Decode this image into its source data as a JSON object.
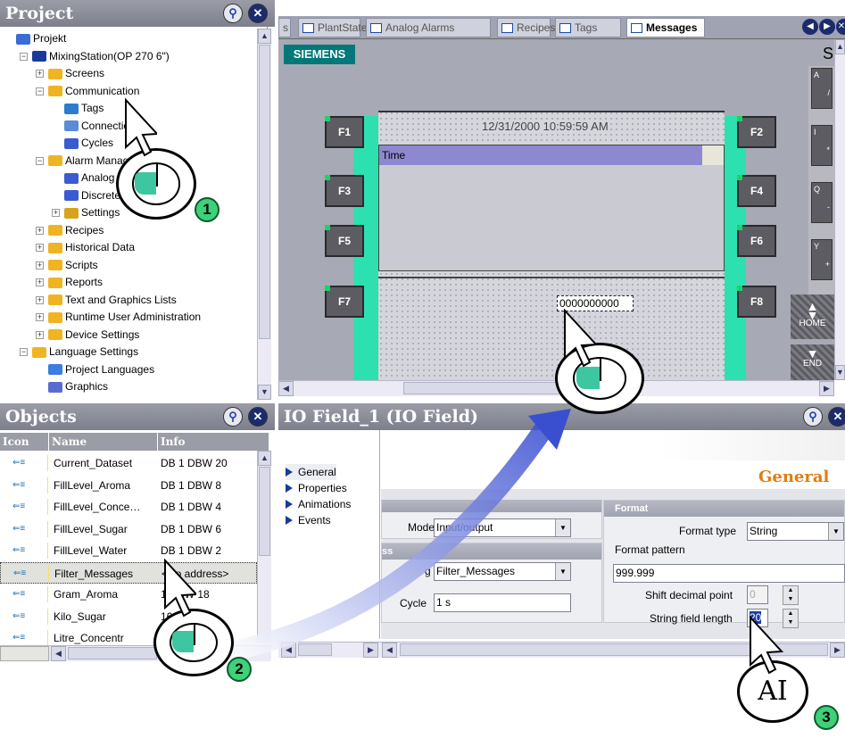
{
  "project_panel": {
    "title": "Project",
    "tree": [
      {
        "label": "Projekt",
        "level": 0,
        "icon": "project-icon",
        "expander": ""
      },
      {
        "label": "MixingStation(OP 270 6\")",
        "level": 1,
        "icon": "device-icon",
        "expander": "−"
      },
      {
        "label": "Screens",
        "level": 2,
        "icon": "folder-icon",
        "expander": "+"
      },
      {
        "label": "Communication",
        "level": 2,
        "icon": "folder-open-icon",
        "expander": "−"
      },
      {
        "label": "Tags",
        "level": 3,
        "icon": "tags-icon",
        "expander": ""
      },
      {
        "label": "Connections",
        "level": 3,
        "icon": "connections-icon",
        "expander": ""
      },
      {
        "label": "Cycles",
        "level": 3,
        "icon": "cycles-icon",
        "expander": ""
      },
      {
        "label": "Alarm Management",
        "level": 2,
        "icon": "folder-open-icon",
        "expander": "−"
      },
      {
        "label": "Analog Alarms",
        "level": 3,
        "icon": "analog-alarm-icon",
        "expander": ""
      },
      {
        "label": "Discrete Alarms",
        "level": 3,
        "icon": "discrete-alarm-icon",
        "expander": ""
      },
      {
        "label": "Settings",
        "level": 3,
        "icon": "settings-icon",
        "expander": "+"
      },
      {
        "label": "Recipes",
        "level": 2,
        "icon": "folder-icon",
        "expander": "+"
      },
      {
        "label": "Historical Data",
        "level": 2,
        "icon": "folder-icon",
        "expander": "+"
      },
      {
        "label": "Scripts",
        "level": 2,
        "icon": "folder-icon",
        "expander": "+"
      },
      {
        "label": "Reports",
        "level": 2,
        "icon": "folder-icon",
        "expander": "+"
      },
      {
        "label": "Text and Graphics Lists",
        "level": 2,
        "icon": "folder-icon",
        "expander": "+"
      },
      {
        "label": "Runtime User Administration",
        "level": 2,
        "icon": "folder-icon",
        "expander": "+"
      },
      {
        "label": "Device Settings",
        "level": 2,
        "icon": "folder-icon",
        "expander": "+"
      },
      {
        "label": "Language Settings",
        "level": 1,
        "icon": "folder-open-icon",
        "expander": "−"
      },
      {
        "label": "Project Languages",
        "level": 2,
        "icon": "globe-icon",
        "expander": ""
      },
      {
        "label": "Graphics",
        "level": 2,
        "icon": "graphics-icon",
        "expander": ""
      }
    ]
  },
  "tabs": [
    {
      "label": "s",
      "icon": ""
    },
    {
      "label": "PlantState",
      "icon": "screen-icon"
    },
    {
      "label": "Analog Alarms",
      "icon": "analog-alarm-icon"
    },
    {
      "label": "Recipes",
      "icon": "screen-icon"
    },
    {
      "label": "Tags",
      "icon": "tags-icon"
    },
    {
      "label": "Messages",
      "icon": "screen-icon",
      "active": true
    }
  ],
  "screen": {
    "brand": "SIEMENS",
    "corner_letter": "S",
    "datetime": "12/31/2000 10:59:59 AM",
    "column_time": "Time",
    "io_field_value": "0000000000",
    "fkeys_left": [
      "F1",
      "F3",
      "F5",
      "F7"
    ],
    "fkeys_right": [
      "F2",
      "F4",
      "F6",
      "F8"
    ],
    "side_keys": [
      {
        "top": "A",
        "bottom": "/"
      },
      {
        "top": "I",
        "bottom": "*"
      },
      {
        "top": "Q",
        "bottom": "-"
      },
      {
        "top": "Y",
        "bottom": "+"
      }
    ],
    "home_label": "HOME",
    "end_label": "END"
  },
  "objects_panel": {
    "title": "Objects",
    "columns": [
      "Icon",
      "Name",
      "Info"
    ],
    "rows": [
      {
        "name": "Current_Dataset",
        "info": "DB 1 DBW 20"
      },
      {
        "name": "FillLevel_Aroma",
        "info": "DB 1 DBW 8"
      },
      {
        "name": "FillLevel_Conce…",
        "info": "DB 1 DBW 4"
      },
      {
        "name": "FillLevel_Sugar",
        "info": "DB 1 DBW 6"
      },
      {
        "name": "FillLevel_Water",
        "info": "DB 1 DBW 2"
      },
      {
        "name": "Filter_Messages",
        "info": "<No address>",
        "selected": true
      },
      {
        "name": "Gram_Aroma",
        "info": "1 DBW 18"
      },
      {
        "name": "Kilo_Sugar",
        "info": "16"
      },
      {
        "name": "Litre_Concentr",
        "info": ""
      }
    ]
  },
  "properties": {
    "title": "IO Field_1 (IO Field)",
    "nav": [
      "General",
      "Properties",
      "Animations",
      "Events"
    ],
    "section_title": "General",
    "mode_label": "Mode",
    "mode_value": "Input/output",
    "process_header": "ss",
    "tag_label": "g",
    "tag_value": "Filter_Messages",
    "cycle_label": "Cycle",
    "cycle_value": "1 s",
    "format_header": "Format",
    "format_type_label": "Format type",
    "format_type_value": "String",
    "format_pattern_label": "Format pattern",
    "format_pattern_value": "999.999",
    "shift_label": "Shift decimal point",
    "shift_value": "0",
    "string_len_label": "String field length",
    "string_len_value": "20"
  },
  "callouts": [
    "1",
    "2",
    "3"
  ],
  "text_cursor_glyph": "AI"
}
